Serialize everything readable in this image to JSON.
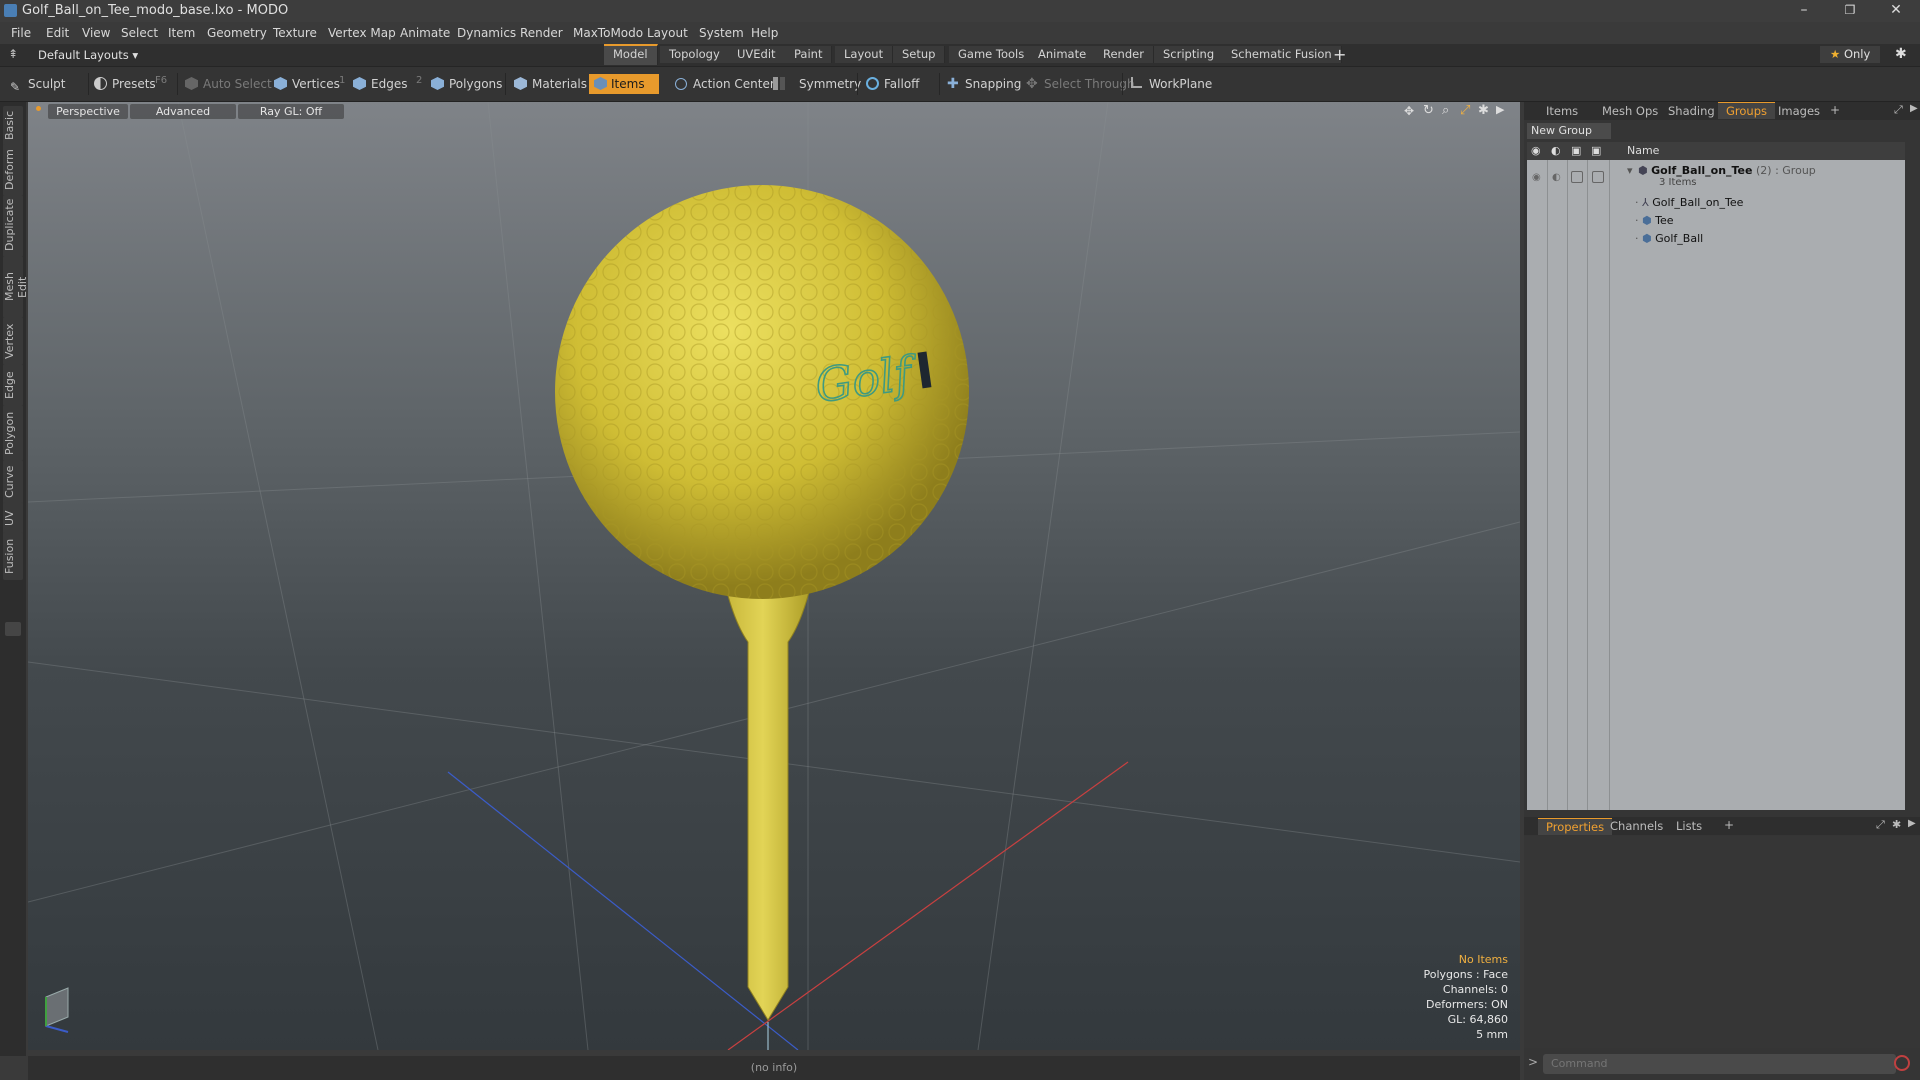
{
  "window": {
    "title": "Golf_Ball_on_Tee_modo_base.lxo - MODO",
    "controls": {
      "minimize": "–",
      "maximize": "❐",
      "close": "✕"
    }
  },
  "menu": [
    "File",
    "Edit",
    "View",
    "Select",
    "Item",
    "Geometry",
    "Texture",
    "Vertex Map",
    "Animate",
    "Dynamics",
    "Render",
    "MaxToModo",
    "Layout",
    "System",
    "Help"
  ],
  "layoutbar": {
    "layout_selector": "Default Layouts ▾",
    "tabs": [
      "Model",
      "Topology",
      "UVEdit",
      "Paint",
      "Layout",
      "Setup",
      "Game Tools",
      "Animate",
      "Render",
      "Scripting",
      "Schematic Fusion"
    ],
    "active_tab": "Model",
    "add": "+",
    "only_label": "Only"
  },
  "toolbar": {
    "sculpt": "Sculpt",
    "presets": "Presets",
    "presets_key": "F6",
    "auto_select": "Auto Select",
    "vertices": "Vertices",
    "vertices_key": "1",
    "edges": "Edges",
    "edges_key": "2",
    "polygons": "Polygons",
    "materials": "Materials",
    "items": "Items",
    "action_center": "Action Center",
    "symmetry": "Symmetry",
    "falloff": "Falloff",
    "snapping": "Snapping",
    "select_through": "Select Through",
    "workplane": "WorkPlane"
  },
  "left_tabs": [
    "Basic",
    "Deform",
    "Duplicate",
    "Mesh Edit",
    "Vertex",
    "Edge",
    "Polygon",
    "Curve",
    "UV",
    "Fusion"
  ],
  "viewport": {
    "view_mode": "Perspective",
    "shading": "Advanced",
    "raygl": "Ray GL: Off",
    "ball_logo_text": "Golf",
    "info": {
      "selection": "No Items",
      "polygons": "Polygons : Face",
      "channels": "Channels: 0",
      "deformers": "Deformers: ON",
      "gl": "GL: 64,860",
      "unit": "5 mm"
    },
    "colors": {
      "ball": "#d8c438",
      "tee": "#d4c23c",
      "accent": "#e89a2c"
    }
  },
  "statusbar": {
    "text": "(no info)"
  },
  "right_panel": {
    "tabs": [
      "Items",
      "Mesh Ops",
      "Shading",
      "Groups",
      "Images"
    ],
    "active_tab": "Groups",
    "add": "+",
    "new_group": "New Group",
    "column_name": "Name",
    "group": {
      "name": "Golf_Ball_on_Tee",
      "count": "(2)",
      "type": ": Group",
      "sub": "3 Items"
    },
    "items": [
      "Golf_Ball_on_Tee",
      "Tee",
      "Golf_Ball"
    ]
  },
  "bottom_panel": {
    "tabs": [
      "Properties",
      "Channels",
      "Lists"
    ],
    "active_tab": "Properties",
    "add": "+"
  },
  "command": {
    "placeholder": "Command",
    "prompt": ">"
  }
}
